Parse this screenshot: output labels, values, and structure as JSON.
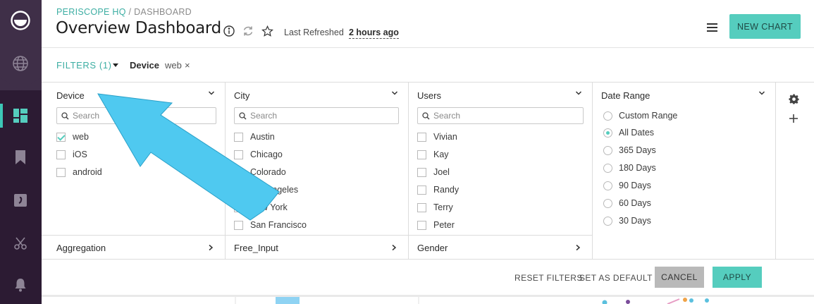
{
  "header": {
    "breadcrumb_org": "PERISCOPE HQ",
    "breadcrumb_sep": "/",
    "breadcrumb_page": "DASHBOARD",
    "title": "Overview Dashboard",
    "refreshed_label": "Last Refreshed",
    "refreshed_value": "2 hours ago",
    "new_chart_label": "NEW CHART"
  },
  "filter_bar": {
    "filters_label": "FILTERS (1)",
    "active_filter_key": "Device",
    "active_filter_value": "web",
    "remove_symbol": "×"
  },
  "panel": {
    "device": {
      "title": "Device",
      "search_placeholder": "Search",
      "options": [
        {
          "label": "web",
          "checked": true
        },
        {
          "label": "iOS",
          "checked": false
        },
        {
          "label": "android",
          "checked": false
        }
      ]
    },
    "city": {
      "title": "City",
      "search_placeholder": "Search",
      "options": [
        {
          "label": "Austin",
          "checked": false
        },
        {
          "label": "Chicago",
          "checked": false
        },
        {
          "label": "Colorado",
          "checked": false
        },
        {
          "label": "Los Angeles",
          "checked": false
        },
        {
          "label": "New York",
          "checked": false
        },
        {
          "label": "San Francisco",
          "checked": false
        }
      ]
    },
    "users": {
      "title": "Users",
      "search_placeholder": "Search",
      "options": [
        {
          "label": "Vivian",
          "checked": false
        },
        {
          "label": "Kay",
          "checked": false
        },
        {
          "label": "Joel",
          "checked": false
        },
        {
          "label": "Randy",
          "checked": false
        },
        {
          "label": "Terry",
          "checked": false
        },
        {
          "label": "Peter",
          "checked": false
        }
      ]
    },
    "date_range": {
      "title": "Date Range",
      "options": [
        {
          "label": "Custom Range",
          "selected": false
        },
        {
          "label": "All Dates",
          "selected": true
        },
        {
          "label": "365 Days",
          "selected": false
        },
        {
          "label": "180 Days",
          "selected": false
        },
        {
          "label": "90 Days",
          "selected": false
        },
        {
          "label": "60 Days",
          "selected": false
        },
        {
          "label": "30 Days",
          "selected": false
        }
      ]
    },
    "sub_filters": {
      "aggregation": "Aggregation",
      "free_input": "Free_Input",
      "gender": "Gender"
    }
  },
  "actions": {
    "reset": "RESET FILTERS",
    "set_default": "SET AS DEFAULT",
    "cancel": "CANCEL",
    "apply": "APPLY"
  },
  "colors": {
    "accent": "#55cdbe",
    "accent_text": "#3daea3",
    "rail_bg": "#2c1b33",
    "annotation_arrow": "#4fc9f0"
  },
  "icons": {
    "rail": [
      "periscope-logo-icon",
      "globe-icon",
      "dashboard-icon",
      "bookmark-icon",
      "sql-icon",
      "scissors-icon",
      "bell-icon"
    ],
    "header": [
      "info-icon",
      "refresh-icon",
      "star-icon",
      "hamburger-menu-icon"
    ],
    "panel_tools": [
      "gear-icon",
      "plus-icon"
    ]
  }
}
